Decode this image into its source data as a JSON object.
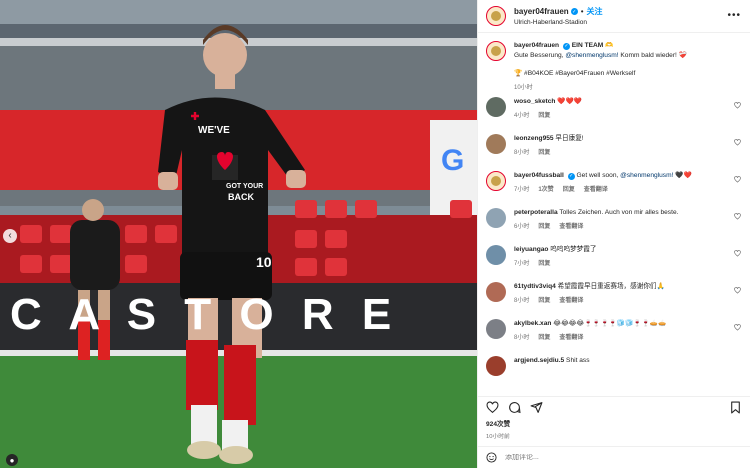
{
  "header": {
    "username": "bayer04frauen",
    "follow_label": "关注",
    "location": "Ulrich-Haberland-Stadion",
    "more": "•••"
  },
  "caption": {
    "username": "bayer04frauen",
    "text_bold": "EIN TEAM 🫶",
    "text_before": "Gute Besserung, ",
    "mention": "@shenmenglusm!",
    "text_after": " Komm bald wieder! ❤️‍🩹",
    "tags": "🏆 #B04KOE #Bayer04Frauen #Werkself",
    "time": "10小时"
  },
  "comments": [
    {
      "username": "woso_sketch",
      "text": "❤️❤️❤️",
      "time": "4小时",
      "likes": "",
      "reply": "回复",
      "translate": ""
    },
    {
      "username": "leonzeng955",
      "text": "早日康复!",
      "time": "8小时",
      "likes": "",
      "reply": "回复",
      "translate": ""
    },
    {
      "username": "bayer04fussball",
      "text_before": "Get well soon, ",
      "mention": "@shenmenglusm!",
      "text_after": " 🖤❤️",
      "time": "7小时",
      "likes": "1次赞",
      "reply": "回复",
      "translate": "查看翻译"
    },
    {
      "username": "peterpoteralla",
      "text": "Tolles Zeichen. Auch von mir alles beste.",
      "time": "6小时",
      "likes": "",
      "reply": "回复",
      "translate": "查看翻译"
    },
    {
      "username": "leiyuangao",
      "text": "呜呜呜梦梦霞了",
      "time": "7小时",
      "likes": "",
      "reply": "回复",
      "translate": ""
    },
    {
      "username": "61tydtiv3viq4",
      "text": "希望霞霞早日重返赛场，感谢你们🙏",
      "time": "8小时",
      "likes": "",
      "reply": "回复",
      "translate": "查看翻译"
    },
    {
      "username": "akylbek.xan",
      "text": "😂😂😂😂🍷🍷🍷🍷🧊🧊🍷🍷🥧🥧",
      "time": "8小时",
      "likes": "",
      "reply": "回复",
      "translate": "查看翻译"
    },
    {
      "username": "argjend.sejdiu.5",
      "text": "Shit ass",
      "time": "",
      "likes": "",
      "reply": "",
      "translate": ""
    }
  ],
  "footer": {
    "likes": "924次赞",
    "time": "10小时前",
    "comment_placeholder": "添加评论..."
  },
  "icons": {
    "heart": "heart-icon",
    "comment": "comment-icon",
    "share": "share-icon",
    "save": "bookmark-icon",
    "emoji": "emoji-icon"
  },
  "photo": {
    "banner_text": "C A S T O R E",
    "shirt_text_1": "WE'VE",
    "shirt_text_2": "GOT YOUR",
    "shirt_text_3": "BACK",
    "shirt_number": "10",
    "sponsor": "Google"
  },
  "colors": {
    "accent": "#0095f6",
    "brand": "#e4032e",
    "link": "#00376b"
  }
}
